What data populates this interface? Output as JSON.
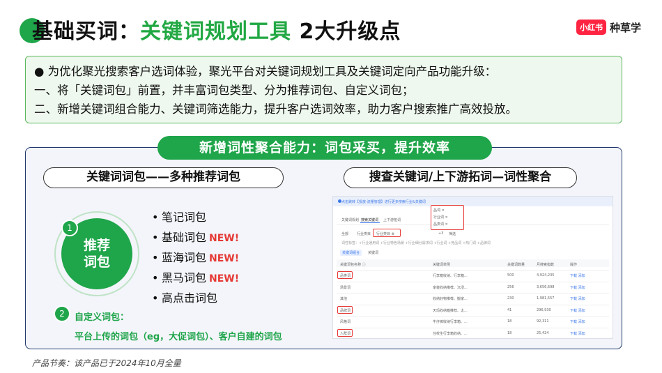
{
  "header": {
    "title_prefix": "基础买词：",
    "title_highlight": "关键词规划工具",
    "title_suffix": " 2大升级点",
    "brand_logo": "小红书",
    "brand_text": "种草学",
    "accent_color": "#1fa54a"
  },
  "intro": {
    "line1": "● 为优化聚光搜索客户选词体验，聚光平台对关键词规划工具及关键词定向产品功能升级：",
    "line2": "一、将「关键词包」前置，并丰富词包类型、分为推荐词包、自定义词包；",
    "line3": "二、新增关键词组合能力、关键词筛选能力，提升客户选词效率，助力客户搜索推广高效投放。"
  },
  "banner": "新增词性聚合能力：词包采买，提升效率",
  "left": {
    "pill": "关键词词包——多种推荐词包",
    "num1": "1",
    "circle_line1": "推荐",
    "circle_line2": "词包",
    "items": [
      {
        "label": "笔记词包",
        "new": ""
      },
      {
        "label": "基础词包",
        "new": "NEW!"
      },
      {
        "label": "蓝海词包",
        "new": "NEW!"
      },
      {
        "label": "黑马词包",
        "new": "NEW!"
      },
      {
        "label": "高点击词包",
        "new": ""
      }
    ],
    "num2": "2",
    "custom_title": "自定义词包：",
    "custom_desc": "平台上传的词包（eg，大促词包）、客户自建的词包"
  },
  "right": {
    "pill": "搜查关键词/上下游拓词—词性聚合",
    "shot": {
      "info": "点击跳转【投放-流量管理】进行更多搜索行业&关键词",
      "popup": [
        "品词 ✕",
        "行业词 ✕",
        "品类词 ✕"
      ],
      "tabs": [
        "关键词规划",
        "搜索关键词",
        "上下游拓词"
      ],
      "filters": [
        "全部",
        "行业类目",
        "行业类目 ⊗",
        "+3",
        "筛选"
      ],
      "hint": "词性标签：+行业通用词 +行业特色场景 +行业细分需求词 +行业词 +竞品词 +热门词 +品牌词",
      "subtabs": [
        "关键词组合",
        "关键词"
      ],
      "columns": [
        "关键词包名称 ⓘ",
        "关键词举例",
        "关键词数量",
        "月搜索指数",
        "操作"
      ],
      "rows": [
        {
          "name": "品类词",
          "ex": "行李箱收纳、行李箱...",
          "count": "500",
          "index": "4,924,235",
          "op": "下载 添加",
          "hl": true
        },
        {
          "name": "场景词",
          "ex": "家装收纳推荐、沉浸...",
          "count": "256",
          "index": "3,656,698",
          "op": "下载 添加",
          "hl": false
        },
        {
          "name": "其他",
          "ex": "收纳好物推荐、搬家...",
          "count": "230",
          "index": "1,981,557",
          "op": "下载 添加",
          "hl": false
        },
        {
          "name": "品牌词",
          "ex": "天玛收纳箱推荐、太...",
          "count": "41",
          "index": "296,930",
          "op": "下载 添加",
          "hl": true
        },
        {
          "name": "风格词",
          "ex": "牛仔裤收纳行李箱、...",
          "count": "18",
          "index": "92,311",
          "op": "下载 添加",
          "hl": false
        },
        {
          "name": "人群词",
          "ex": "住校生行李箱收纳、...",
          "count": "18",
          "index": "25,424",
          "op": "下载 添加",
          "hl": true
        }
      ]
    }
  },
  "footer": "产品节奏：该产品已于2024年10月全量"
}
